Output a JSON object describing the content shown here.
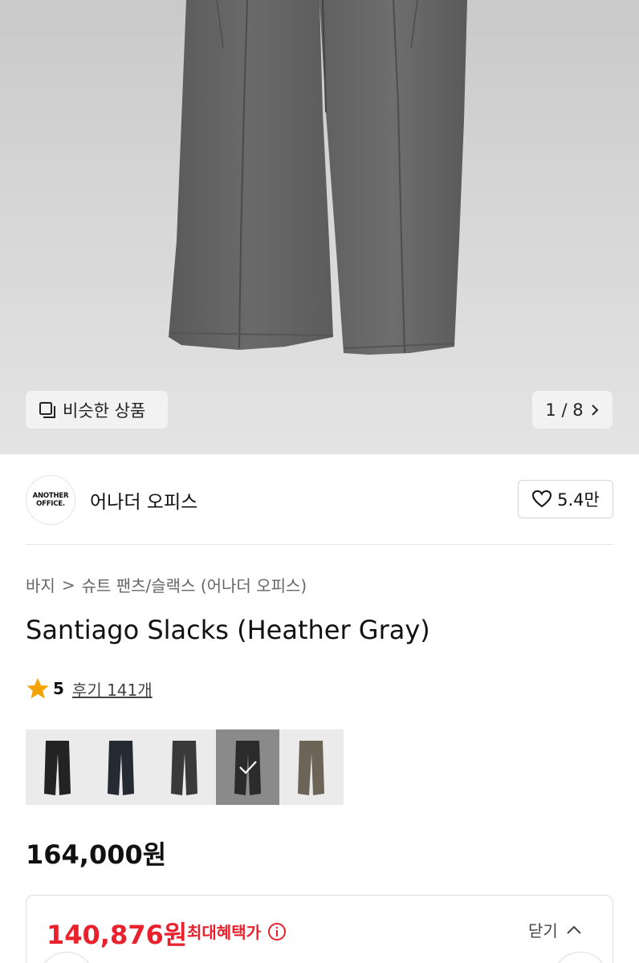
{
  "gallery": {
    "similar_label": "비슷한 상품",
    "counter": "1 / 8"
  },
  "brand": {
    "logo_line1": "ANOTHER",
    "logo_line2": "OFFICE.",
    "name": "어나더 오피스",
    "likes": "5.4만"
  },
  "breadcrumb": {
    "level1": "바지",
    "separator": ">",
    "level2": "슈트 팬츠/슬랙스 (어나더 오피스)"
  },
  "product": {
    "title": "Santiago Slacks (Heather Gray)",
    "rating": "5",
    "reviews": "후기 141개",
    "price": "164,000원"
  },
  "swatches": [
    {
      "name": "black",
      "color": "#232323",
      "selected": false
    },
    {
      "name": "navy",
      "color": "#262a33",
      "selected": false
    },
    {
      "name": "charcoal",
      "color": "#3a3a3a",
      "selected": false
    },
    {
      "name": "heather-gray",
      "color": "#2b2b2b",
      "selected": true
    },
    {
      "name": "khaki",
      "color": "#6b6457",
      "selected": false
    }
  ],
  "benefit": {
    "price": "140,876원",
    "label": "최대혜택가",
    "close_label": "닫기"
  },
  "colors": {
    "accent_red": "#e8212d",
    "star": "#f5a300"
  }
}
